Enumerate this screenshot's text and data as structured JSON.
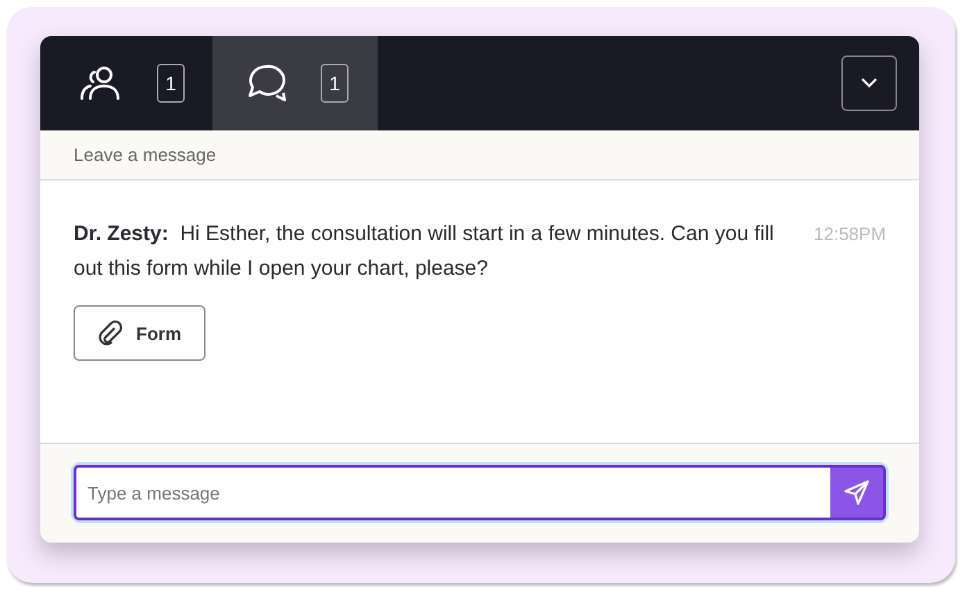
{
  "tabs": [
    {
      "kind": "people",
      "badge": "1",
      "selected": false
    },
    {
      "kind": "chat",
      "badge": "1",
      "selected": true
    }
  ],
  "subheader": "Leave a message",
  "messages": [
    {
      "sender": "Dr. Zesty:",
      "text": "Hi Esther, the consultation will start in a few minutes. Can you fill out this form while I open your chart, please?",
      "time": "12:58PM",
      "attachment": "Form"
    }
  ],
  "composer": {
    "placeholder": "Type a message"
  }
}
